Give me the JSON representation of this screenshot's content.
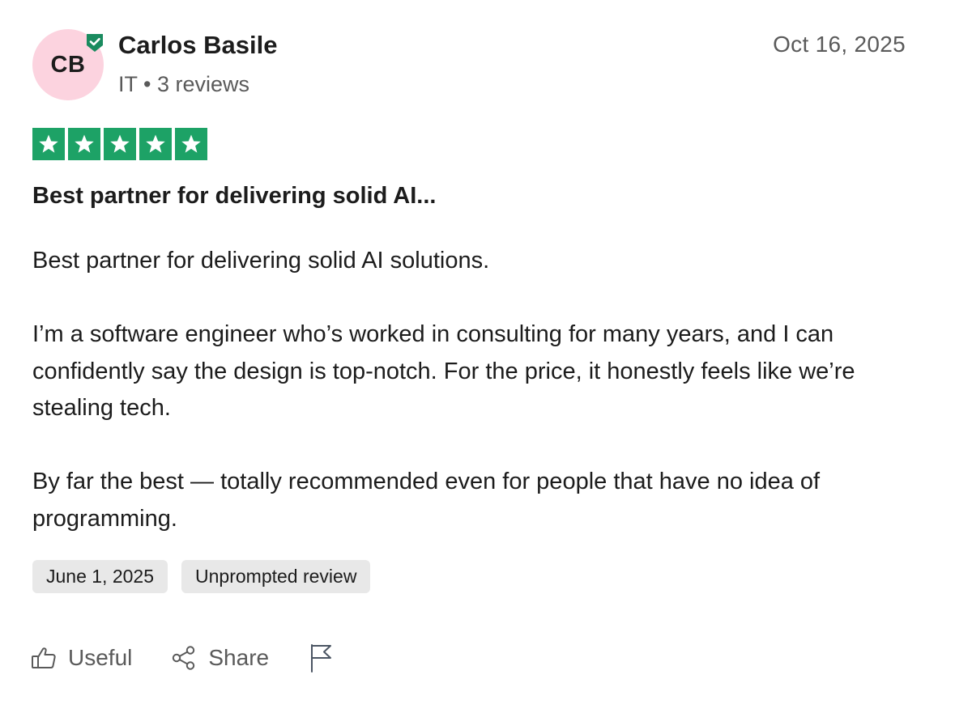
{
  "reviewer": {
    "initials": "CB",
    "name": "Carlos Basile",
    "meta": "IT • 3 reviews",
    "avatar_color": "#fcd3df",
    "verified_icon": "verified-check-icon",
    "verified_color": "#1a8b5f"
  },
  "review": {
    "posted_date": "Oct 16, 2025",
    "rating": 5,
    "rating_max": 5,
    "star_color": "#1da266",
    "title": "Best partner for delivering solid AI...",
    "paragraphs": [
      "Best partner for delivering solid AI solutions.",
      "I’m a software engineer who’s worked in consulting for many years, and I can confidently say the design is top-notch. For the price, it honestly feels like we’re stealing tech.",
      "By far the best — totally recommended even for people that have no idea of programming."
    ],
    "tags": {
      "experience_date": "June 1, 2025",
      "review_type": "Unprompted review"
    }
  },
  "actions": {
    "useful_label": "Useful",
    "useful_icon": "thumbs-up-icon",
    "share_label": "Share",
    "share_icon": "share-icon",
    "flag_icon": "flag-icon"
  }
}
